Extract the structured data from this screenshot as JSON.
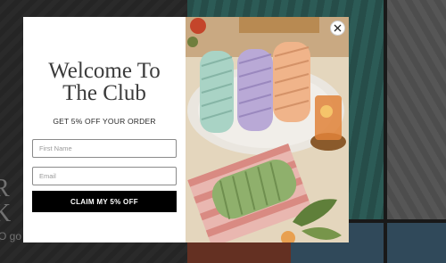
{
  "background": {
    "hero_text": "R F\nK I",
    "hero_sub": "O go"
  },
  "modal": {
    "title": "Welcome To\nThe Club",
    "offer": "GET 5% OFF YOUR ORDER",
    "first_name": {
      "value": "",
      "placeholder": "First Name"
    },
    "email": {
      "value": "",
      "placeholder": "Email"
    },
    "cta_label": "CLAIM MY 5% OFF",
    "close_icon": "close-icon",
    "image_icon": "macrame-cords-photo"
  },
  "colors": {
    "button": "#000000",
    "title": "#3b3b3b",
    "background_teal": "#2f5e5a"
  }
}
